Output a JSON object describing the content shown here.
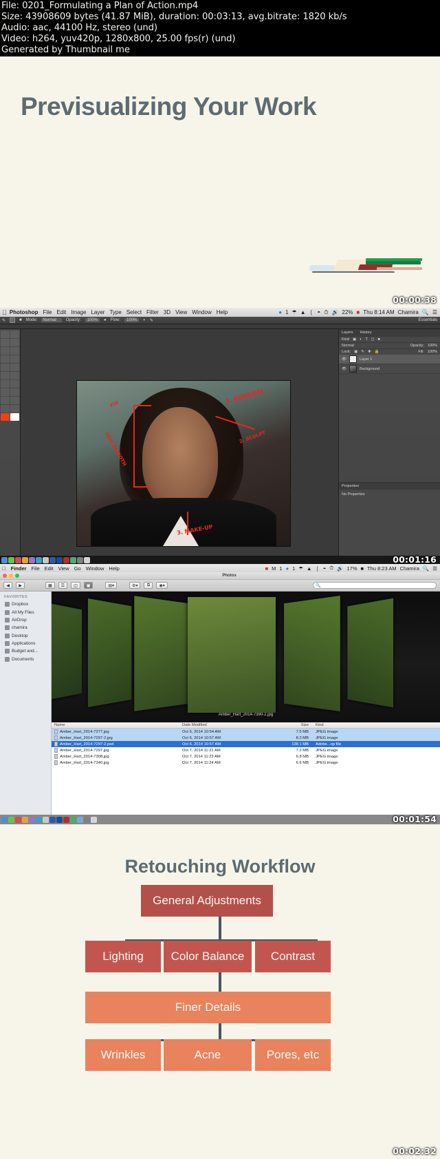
{
  "info_header": {
    "lines": [
      "File: 0201_Formulating a Plan of Action.mp4",
      "Size: 43908609 bytes (41.87 MiB), duration: 00:03:13, avg.bitrate: 1820 kb/s",
      "Audio: aac, 44100 Hz, stereo (und)",
      "Video: h264, yuv420p, 1280x800, 25.00 fps(r) (und)",
      "Generated by Thumbnail me"
    ]
  },
  "timestamps": {
    "t1": "00:00:38",
    "t2": "00:01:16",
    "t3": "00:01:54",
    "t4": "00:02:32"
  },
  "slide1": {
    "title": "Previsualizing Your Work"
  },
  "photoshop": {
    "menubar": {
      "apple": "apple-icon",
      "items": [
        "Photoshop",
        "File",
        "Edit",
        "Image",
        "Layer",
        "Type",
        "Select",
        "Filter",
        "3D",
        "View",
        "Window",
        "Help"
      ],
      "status": [
        "1",
        "22%",
        "Thu 8:14 AM",
        "Chamira"
      ],
      "search_icon": "search-icon",
      "list_icon": "menu-icon"
    },
    "options_bar": {
      "mode_label": "Mode:",
      "mode_value": "Normal",
      "opacity_label": "Opacity:",
      "opacity_value": "100%",
      "flow_label": "Flow:",
      "flow_value": "100%",
      "workspace": "Essentials"
    },
    "panels": {
      "tabs": [
        "Layers",
        "History"
      ],
      "filter_placeholder": "Kind",
      "blend_mode": "Normal",
      "opacity_label": "Opacity:",
      "opacity_value": "100%",
      "lock_label": "Lock:",
      "fill_label": "Fill:",
      "fill_value": "100%",
      "layers": [
        {
          "name": "Layer 1",
          "selected": true
        },
        {
          "name": "Background",
          "selected": false
        }
      ],
      "properties_title": "Properties",
      "properties_empty": "No Properties"
    },
    "annotations": [
      "1. GENERAL",
      "2. SCULPT",
      "3. MAKE-UP",
      "SKIN SMOOTH",
      "FIX"
    ]
  },
  "finder": {
    "menubar": {
      "items": [
        "Finder",
        "File",
        "Edit",
        "View",
        "Go",
        "Window",
        "Help"
      ],
      "status": [
        "1",
        "1",
        "17%",
        "Thu 8:23 AM",
        "Chamira"
      ]
    },
    "window_title": "Photos",
    "toolbar": {
      "back_icon": "chevron-left-icon",
      "forward_icon": "chevron-right-icon",
      "view_icons": [
        "icon-view-icon",
        "list-view-icon",
        "column-view-icon",
        "coverflow-view-icon"
      ],
      "arrange_icon": "arrange-icon",
      "action_icon": "gear-icon",
      "share_icon": "share-icon",
      "tag_icon": "tag-icon",
      "search_placeholder": ""
    },
    "sidebar": {
      "header": "FAVORITES",
      "items": [
        "Dropbox",
        "All My Files",
        "AirDrop",
        "chamira",
        "Desktop",
        "Applications",
        "Budget and...",
        "Documents"
      ]
    },
    "coverflow_caption": "Amber_Hart_2014-7390-2.jpg",
    "file_list": {
      "columns": [
        "Name",
        "Date Modified",
        "Size",
        "Kind"
      ],
      "rows": [
        {
          "name": "Amber_Hart_2014-7277.jpg",
          "date": "Oct 6, 2014 10:54 AM",
          "size": "7.5 MB",
          "kind": "JPEG image",
          "state": "light"
        },
        {
          "name": "Amber_Hart_2014-7297-2.jpg",
          "date": "Oct 6, 2014 10:57 AM",
          "size": "8.3 MB",
          "kind": "JPEG image",
          "state": "light"
        },
        {
          "name": "Amber_Hart_2014-7297-2.psd",
          "date": "Oct 6, 2014 10:57 AM",
          "size": "138.1 MB",
          "kind": "Adobe...op file",
          "state": "dark"
        },
        {
          "name": "Amber_Hart_2014-7297.jpg",
          "date": "Oct 7, 2014 11:21 AM",
          "size": "7.2 MB",
          "kind": "JPEG image",
          "state": "none"
        },
        {
          "name": "Amber_Hart_2014-7308.jpg",
          "date": "Oct 7, 2014 11:23 AM",
          "size": "6.8 MB",
          "kind": "JPEG image",
          "state": "none"
        },
        {
          "name": "Amber_Hart_2014-7340.jpg",
          "date": "Oct 7, 2014 11:24 AM",
          "size": "6.6 MB",
          "kind": "JPEG image",
          "state": "none"
        }
      ]
    }
  },
  "slide2": {
    "title": "Retouching Workflow",
    "nodes": {
      "general": "General Adjustments",
      "lighting": "Lighting",
      "color_balance": "Color Balance",
      "contrast": "Contrast",
      "finer_details": "Finer Details",
      "wrinkles": "Wrinkles",
      "acne": "Acne",
      "pores": "Pores, etc"
    }
  },
  "colors": {
    "slide_bg": "#f7f5e9",
    "heading": "#5d6b72",
    "node_dark": "#b4504a",
    "node_light": "#e8835d",
    "connector": "#4a5560",
    "annotation_red": "#e8261c",
    "finder_selection": "#2b6fd3"
  }
}
